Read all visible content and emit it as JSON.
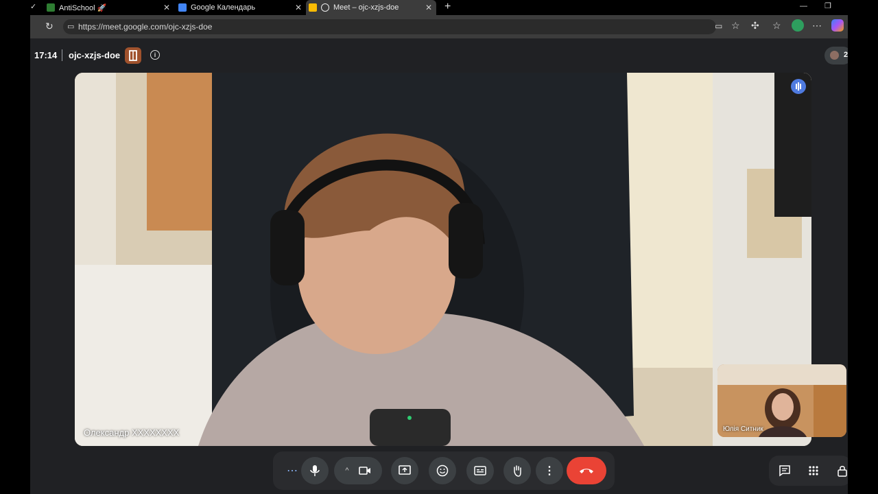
{
  "browser": {
    "tabs": [
      {
        "title": "AntiSchool 🚀"
      },
      {
        "title": "Google Календарь"
      },
      {
        "title": "Meet – ojc-xzjs-doe"
      }
    ],
    "url": "https://meet.google.com/ojc-xzjs-doe"
  },
  "meet": {
    "time": "17:14",
    "meeting_code": "ojc-xzjs-doe",
    "participant_count": "2",
    "main_participant": "Олександр ХХХХХХХХ",
    "self_participant": "Юлія Ситник"
  },
  "colors": {
    "end_call": "#ea4335",
    "speaker_indicator": "#4f7be0",
    "accent_badge": "#a0522d"
  }
}
